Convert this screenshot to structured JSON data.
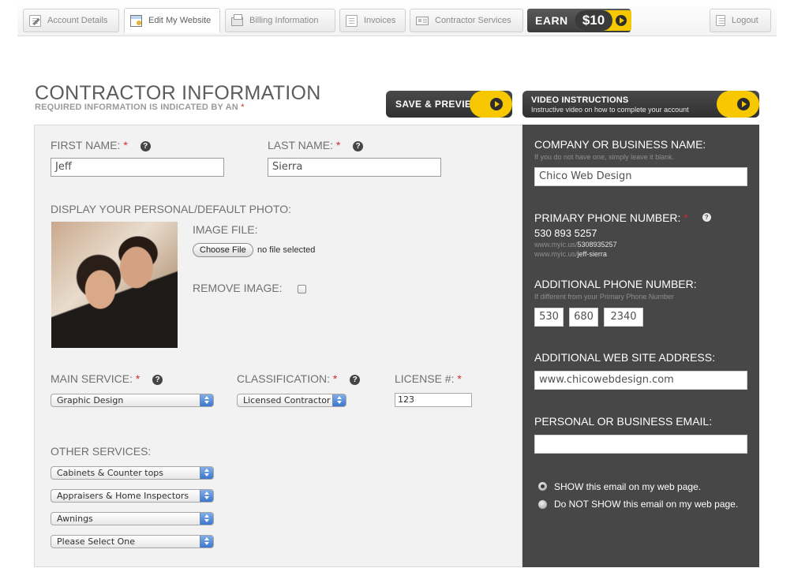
{
  "nav": {
    "tabs": [
      {
        "label": "Account Details",
        "icon": "pencil-document-icon"
      },
      {
        "label": "Edit My Website",
        "icon": "webpage-icon"
      },
      {
        "label": "Billing Information",
        "icon": "printer-icon"
      },
      {
        "label": "Invoices",
        "icon": "document-icon"
      },
      {
        "label": "Contractor Services",
        "icon": "card-icon"
      }
    ],
    "active_tab": "Edit My Website",
    "earn_label": "EARN",
    "earn_amount": "$10",
    "logout_label": "Logout"
  },
  "header": {
    "title": "CONTRACTOR INFORMATION",
    "subtitle": "REQUIRED INFORMATION IS INDICATED BY AN",
    "required_marker": "*",
    "save_preview_label": "SAVE & PREVIEW",
    "video_title": "VIDEO INSTRUCTIONS",
    "video_subtitle": "Instructive video on how to complete your account"
  },
  "form": {
    "first_name_label": "FIRST NAME:",
    "first_name_value": "Jeff",
    "last_name_label": "LAST NAME:",
    "last_name_value": "Sierra",
    "photo_label": "DISPLAY YOUR PERSONAL/DEFAULT PHOTO:",
    "image_file_label": "IMAGE FILE:",
    "choose_file_label": "Choose File",
    "no_file_text": "no file selected",
    "remove_image_label": "REMOVE IMAGE:",
    "remove_image_checked": false,
    "main_service_label": "MAIN SERVICE:",
    "main_service_value": "Graphic Design",
    "classification_label": "CLASSIFICATION:",
    "classification_value": "Licensed Contractor",
    "license_label": "LICENSE #:",
    "license_value": "123",
    "other_services_label": "OTHER SERVICES:",
    "other_services": [
      "Cabinets & Counter tops",
      "Appraisers & Home Inspectors",
      "Awnings",
      "Please Select One"
    ]
  },
  "contact": {
    "company_label": "COMPANY OR BUSINESS NAME:",
    "company_hint": "If you do not have one, simply leave it blank.",
    "company_value": "Chico Web Design",
    "primary_phone_label": "PRIMARY PHONE NUMBER:",
    "primary_phone_value": "530 893 5257",
    "primary_phone_url_prefix_1": "www.myic.us/",
    "primary_phone_url_suffix_1": "5308935257",
    "primary_phone_url_prefix_2": "www.myic.us/",
    "primary_phone_url_suffix_2": "jeff-sierra",
    "additional_phone_label": "ADDITIONAL PHONE NUMBER:",
    "additional_phone_hint": "If different from your Primary Phone Number",
    "additional_phone": [
      "530",
      "680",
      "2340"
    ],
    "website_label": "ADDITIONAL WEB SITE ADDRESS:",
    "website_value": "www.chicowebdesign.com",
    "email_label": "PERSONAL OR BUSINESS EMAIL:",
    "email_value": "",
    "show_email_label": "SHOW this email on my web page.",
    "hide_email_label": "Do NOT SHOW this email on my web page.",
    "email_visibility": "show"
  },
  "colors": {
    "accent_yellow": "#f7c800",
    "dark_panel": "#474747",
    "required_red": "#d42a2a"
  }
}
